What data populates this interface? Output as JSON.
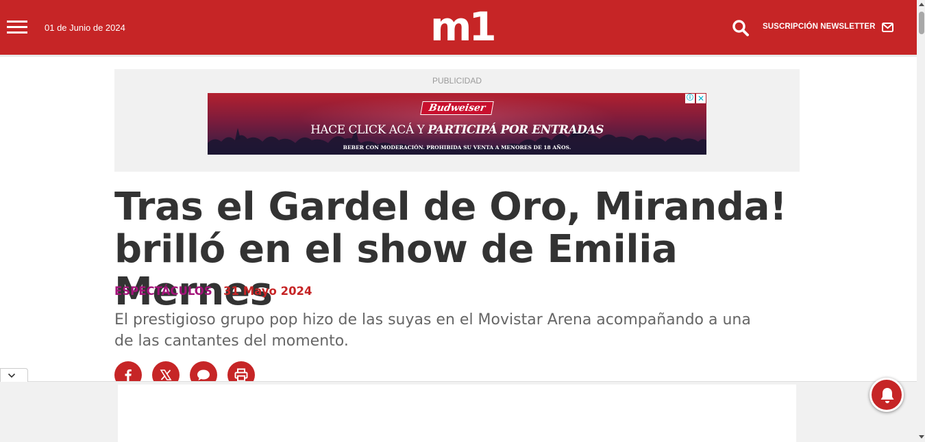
{
  "header": {
    "date": "01 de Junio de 2024",
    "logo": "m1",
    "newsletter_label": "SUSCRIPCIÓN NEWSLETTER",
    "bg_color": "#c62526"
  },
  "ad": {
    "label": "PUBLICIDAD",
    "banner": {
      "brand": "Budweiser",
      "headline_plain": "HACE CLICK ACÁ Y ",
      "headline_emph": "PARTICIPÁ POR ENTRADAS",
      "disclaimer": "BEBER CON MODERACIÓN. PROHIBIDA SU VENTA A MENORES DE 18 AÑOS.",
      "adchoices_icon": "ⓘ",
      "close_icon": "✕"
    }
  },
  "article": {
    "title_line1": "Tras el Gardel de Oro, Miranda!",
    "title_line2": "brilló en el show de Emilia Mernes",
    "category": "ESPECTÁCULOS",
    "date": "31 Mayo 2024",
    "summary_line1": "El prestigioso grupo pop hizo de las suyas en el Movistar Arena acompañando a una",
    "summary_line2": "de las cantantes del momento.",
    "category_color": "#a3137a",
    "date_color": "#c62526"
  },
  "share": {
    "icons": [
      "facebook-icon",
      "x-icon",
      "comment-icon",
      "print-icon"
    ]
  },
  "icons": {
    "menu": "hamburger-icon",
    "search": "search-icon",
    "mail": "mail-icon",
    "collapse": "chevron-down-icon",
    "notifications": "bell-icon"
  }
}
